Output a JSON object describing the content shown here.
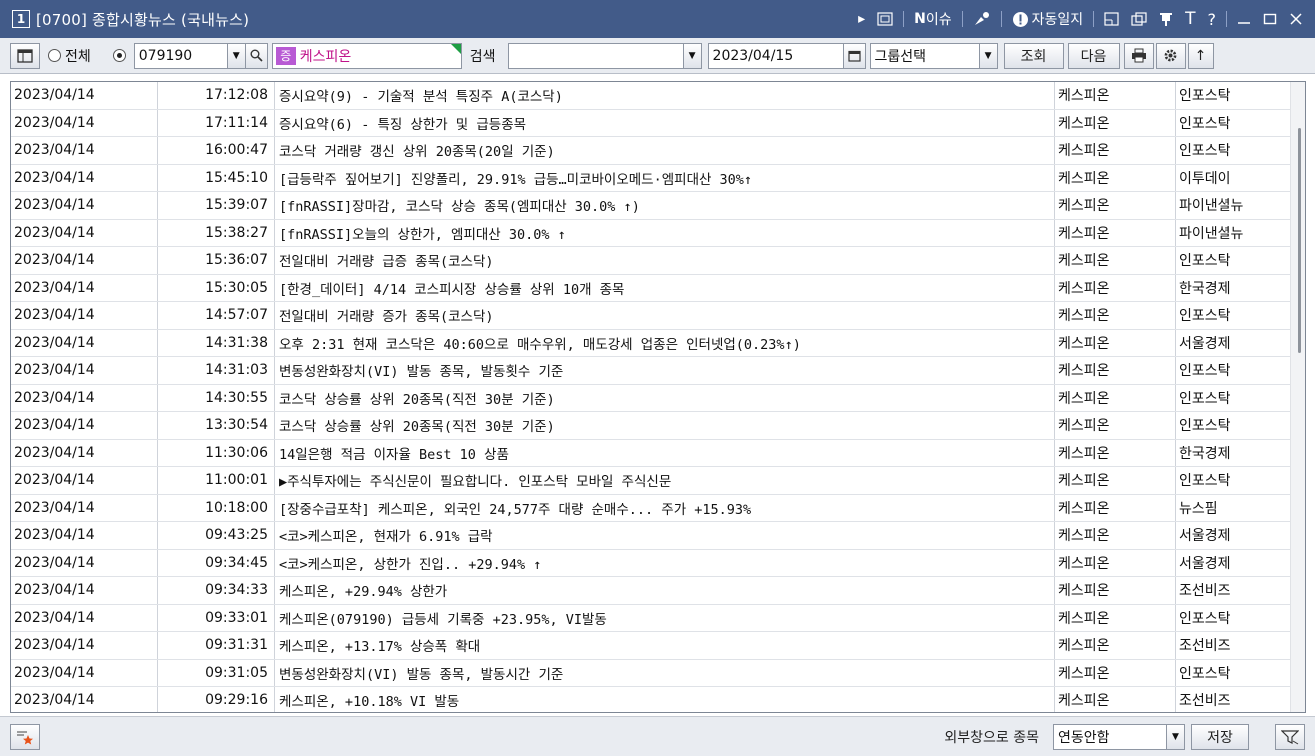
{
  "window": {
    "number": "1",
    "title": "[0700] 종합시황뉴스 (국내뉴스)",
    "issue_label": "이슈",
    "issue_prefix": "N",
    "auto_journal_label": "자동일지",
    "font_label": "T",
    "help_label": "?"
  },
  "toolbar": {
    "radio_all_label": "전체",
    "stock_code": "079190",
    "stock_badge": "증",
    "stock_name": "케스피온",
    "search_label": "검색",
    "search_value": "",
    "date_value": "2023/04/15",
    "group_select_label": "그룹선택",
    "query_button": "조회",
    "next_button": "다음",
    "up_arrow": "↑"
  },
  "news_rows": [
    {
      "date": "2023/04/14",
      "time": "17:12:08",
      "title": "증시요약(9) - 기술적 분석 특징주 A(코스닥)",
      "stock": "케스피온",
      "source": "인포스탁"
    },
    {
      "date": "2023/04/14",
      "time": "17:11:14",
      "title": "증시요약(6) - 특징 상한가 및 급등종목",
      "stock": "케스피온",
      "source": "인포스탁"
    },
    {
      "date": "2023/04/14",
      "time": "16:00:47",
      "title": "코스닥 거래량 갱신 상위 20종목(20일 기준)",
      "stock": "케스피온",
      "source": "인포스탁"
    },
    {
      "date": "2023/04/14",
      "time": "15:45:10",
      "title": "[급등락주 짚어보기] 진양폴리, 29.91% 급등…미코바이오메드·엠피대산 30%↑",
      "stock": "케스피온",
      "source": "이투데이"
    },
    {
      "date": "2023/04/14",
      "time": "15:39:07",
      "title": "[fnRASSI]장마감, 코스닥 상승 종목(엠피대산 30.0% ↑)",
      "stock": "케스피온",
      "source": "파이낸셜뉴"
    },
    {
      "date": "2023/04/14",
      "time": "15:38:27",
      "title": "[fnRASSI]오늘의 상한가, 엠피대산 30.0% ↑",
      "stock": "케스피온",
      "source": "파이낸셜뉴"
    },
    {
      "date": "2023/04/14",
      "time": "15:36:07",
      "title": "전일대비 거래량 급증 종목(코스닥)",
      "stock": "케스피온",
      "source": "인포스탁"
    },
    {
      "date": "2023/04/14",
      "time": "15:30:05",
      "title": "[한경_데이터] 4/14 코스피시장 상승률 상위 10개 종목",
      "stock": "케스피온",
      "source": "한국경제"
    },
    {
      "date": "2023/04/14",
      "time": "14:57:07",
      "title": "전일대비 거래량 증가 종목(코스닥)",
      "stock": "케스피온",
      "source": "인포스탁"
    },
    {
      "date": "2023/04/14",
      "time": "14:31:38",
      "title": "오후 2:31 현재 코스닥은 40:60으로 매수우위, 매도강세 업종은 인터넷업(0.23%↑)",
      "stock": "케스피온",
      "source": "서울경제"
    },
    {
      "date": "2023/04/14",
      "time": "14:31:03",
      "title": "변동성완화장치(VI) 발동 종목, 발동횟수 기준",
      "stock": "케스피온",
      "source": "인포스탁"
    },
    {
      "date": "2023/04/14",
      "time": "14:30:55",
      "title": "코스닥 상승률 상위 20종목(직전 30분 기준)",
      "stock": "케스피온",
      "source": "인포스탁"
    },
    {
      "date": "2023/04/14",
      "time": "13:30:54",
      "title": "코스닥 상승률 상위 20종목(직전 30분 기준)",
      "stock": "케스피온",
      "source": "인포스탁"
    },
    {
      "date": "2023/04/14",
      "time": "11:30:06",
      "title": "14일은행 적금 이자율 Best 10 상품",
      "stock": "케스피온",
      "source": "한국경제"
    },
    {
      "date": "2023/04/14",
      "time": "11:00:01",
      "title": "▶주식투자에는 주식신문이 필요합니다. 인포스탁 모바일 주식신문",
      "stock": "케스피온",
      "source": "인포스탁"
    },
    {
      "date": "2023/04/14",
      "time": "10:18:00",
      "title": "[장중수급포착] 케스피온, 외국인 24,577주 대량 순매수... 주가 +15.93%",
      "stock": "케스피온",
      "source": "뉴스핌"
    },
    {
      "date": "2023/04/14",
      "time": "09:43:25",
      "title": "<코>케스피온, 현재가 6.91% 급락",
      "stock": "케스피온",
      "source": "서울경제"
    },
    {
      "date": "2023/04/14",
      "time": "09:34:45",
      "title": "<코>케스피온, 상한가 진입.. +29.94% ↑",
      "stock": "케스피온",
      "source": "서울경제"
    },
    {
      "date": "2023/04/14",
      "time": "09:34:33",
      "title": "케스피온, +29.94% 상한가",
      "stock": "케스피온",
      "source": "조선비즈"
    },
    {
      "date": "2023/04/14",
      "time": "09:33:01",
      "title": "케스피온(079190) 급등세 기록중 +23.95%, VI발동",
      "stock": "케스피온",
      "source": "인포스탁"
    },
    {
      "date": "2023/04/14",
      "time": "09:31:31",
      "title": "케스피온, +13.17% 상승폭 확대",
      "stock": "케스피온",
      "source": "조선비즈"
    },
    {
      "date": "2023/04/14",
      "time": "09:31:05",
      "title": "변동성완화장치(VI) 발동 종목, 발동시간 기준",
      "stock": "케스피온",
      "source": "인포스탁"
    },
    {
      "date": "2023/04/14",
      "time": "09:29:16",
      "title": "케스피온, +10.18% VI 발동",
      "stock": "케스피온",
      "source": "조선비즈"
    }
  ],
  "statusbar": {
    "external_label": "외부창으로 종목",
    "link_value": "연동안함",
    "save_button": "저장"
  },
  "colors": {
    "titlebar": "#425b89",
    "stock_badge": "#b85ad4",
    "stock_corner": "#1e9e44"
  }
}
